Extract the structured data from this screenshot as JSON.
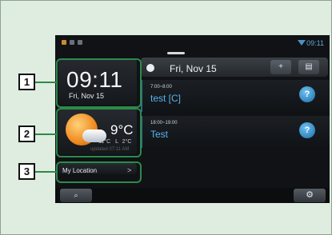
{
  "statusbar": {
    "time": "09:11"
  },
  "clock": {
    "time": "09:11",
    "date": "Fri, Nov 15"
  },
  "weather": {
    "temp": "9°C",
    "low_label": "11°C",
    "l_sep": "L",
    "high_label": "2°C",
    "updated": "updated 07:11 AM"
  },
  "location": {
    "label": "My Location",
    "chevron": ">"
  },
  "calendar": {
    "date": "Fri, Nov 15",
    "events": [
      {
        "time": "7:00~8:00",
        "title": "test [C]"
      },
      {
        "time": "18:00~19:00",
        "title": "Test"
      }
    ]
  },
  "callouts": [
    "1",
    "2",
    "3"
  ],
  "colors": {
    "frame_bg": "#dfece0",
    "accent_blue": "#56b5ee",
    "callout_green": "#2c8a4a"
  },
  "icons": {
    "refresh": "refresh-icon",
    "add_event": "add-event-icon",
    "calendar": "calendar-icon",
    "voice": "voice-icon",
    "search": "search-icon",
    "gear": "gear-icon",
    "wifi": "wifi-icon"
  }
}
